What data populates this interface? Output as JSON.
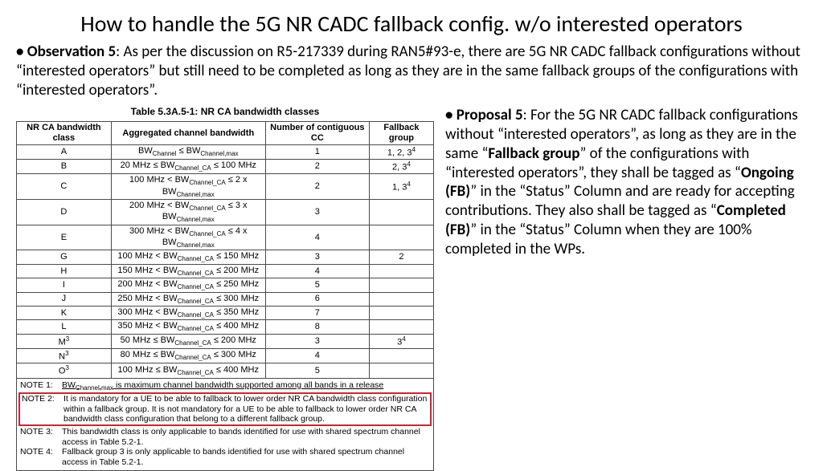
{
  "title": "How to handle the 5G NR CADC fallback config. w/o interested operators",
  "observation": {
    "label": "Observation 5",
    "text": ": As per the discussion on R5-217339 during RAN5#93-e, there are 5G NR CADC fallback configurations without “interested operators” but still need to be completed as long as they are in the same fallback groups of the configurations with “interested operators”."
  },
  "table": {
    "caption": "Table 5.3A.5-1: NR CA bandwidth classes",
    "headers": [
      "NR CA bandwidth class",
      "Aggregated channel bandwidth",
      "Number of contiguous CC",
      "Fallback group"
    ],
    "rows": [
      {
        "c": "A",
        "bw": "BW<sub>Channel</sub> ≤ BW<sub>Channel,max</sub>",
        "cc": "1",
        "fg": "1, 2, 3<sup>4</sup>"
      },
      {
        "c": "B",
        "bw": "20 MHz ≤ BW<sub>Channel_CA</sub> ≤ 100 MHz",
        "cc": "2",
        "fg": "2, 3<sup>4</sup>"
      },
      {
        "c": "C",
        "bw": "100 MHz < BW<sub>Channel_CA</sub> ≤ 2 x BW<sub>Channel,max</sub>",
        "cc": "2",
        "fg": "1, 3<sup>4</sup>"
      },
      {
        "c": "D",
        "bw": "200 MHz < BW<sub>Channel_CA</sub> ≤ 3 x BW<sub>Channel,max</sub>",
        "cc": "3",
        "fg": ""
      },
      {
        "c": "E",
        "bw": "300 MHz < BW<sub>Channel_CA</sub> ≤ 4 x BW<sub>Channel,max</sub>",
        "cc": "4",
        "fg": ""
      },
      {
        "c": "G",
        "bw": "100 MHz < BW<sub>Channel_CA</sub> ≤ 150 MHz",
        "cc": "3",
        "fg": "2"
      },
      {
        "c": "H",
        "bw": "150 MHz < BW<sub>Channel_CA</sub> ≤ 200 MHz",
        "cc": "4",
        "fg": ""
      },
      {
        "c": "I",
        "bw": "200 MHz < BW<sub>Channel_CA</sub> ≤ 250 MHz",
        "cc": "5",
        "fg": ""
      },
      {
        "c": "J",
        "bw": "250 MHz < BW<sub>Channel_CA</sub> ≤ 300 MHz",
        "cc": "6",
        "fg": ""
      },
      {
        "c": "K",
        "bw": "300 MHz < BW<sub>Channel_CA</sub> ≤ 350 MHz",
        "cc": "7",
        "fg": ""
      },
      {
        "c": "L",
        "bw": "350 MHz < BW<sub>Channel_CA</sub> ≤ 400 MHz",
        "cc": "8",
        "fg": ""
      },
      {
        "c": "M<sup>3</sup>",
        "bw": "50 MHz ≤ BW<sub>Channel_CA</sub> ≤ 200 MHz",
        "cc": "3",
        "fg": "3<sup>4</sup>"
      },
      {
        "c": "N<sup>3</sup>",
        "bw": "80 MHz ≤ BW<sub>Channel_CA</sub> ≤ 300 MHz",
        "cc": "4",
        "fg": ""
      },
      {
        "c": "O<sup>3</sup>",
        "bw": "100 MHz ≤ BW<sub>Channel_CA</sub> ≤ 400 MHz",
        "cc": "5",
        "fg": ""
      }
    ],
    "notes": [
      {
        "k": "NOTE 1:",
        "v": "BW<sub>Channel,max</sub> is maximum channel bandwidth supported among all bands in a release",
        "u": true
      },
      {
        "k": "NOTE 2:",
        "v": "It is mandatory for a UE to be able to fallback to lower order NR CA bandwidth class configuration within a fallback group. It is not mandatory for a UE to be able to fallback to lower order NR CA bandwidth class configuration that belong to a different fallback group.",
        "hl": true
      },
      {
        "k": "NOTE 3:",
        "v": "This bandwidth class is only applicable to bands identified for use with shared spectrum channel access in Table 5.2-1."
      },
      {
        "k": "NOTE 4:",
        "v": "Fallback group 3 is only applicable to bands identified for use with shared spectrum channel access in Table 5.2-1."
      }
    ]
  },
  "proposal": {
    "label": "Proposal 5",
    "parts": [
      ": For the 5G NR CADC fallback configurations without “interested operators”, as long as they are in the same “",
      "Fallback group",
      "” of the configurations with “interested operators”, they shall be tagged as “",
      "Ongoing (FB)",
      "” in the “Status” Column and are ready for accepting contributions. They also shall be tagged as “",
      "Completed (FB)",
      "” in the “Status” Column when they are 100% completed in the WPs."
    ]
  }
}
